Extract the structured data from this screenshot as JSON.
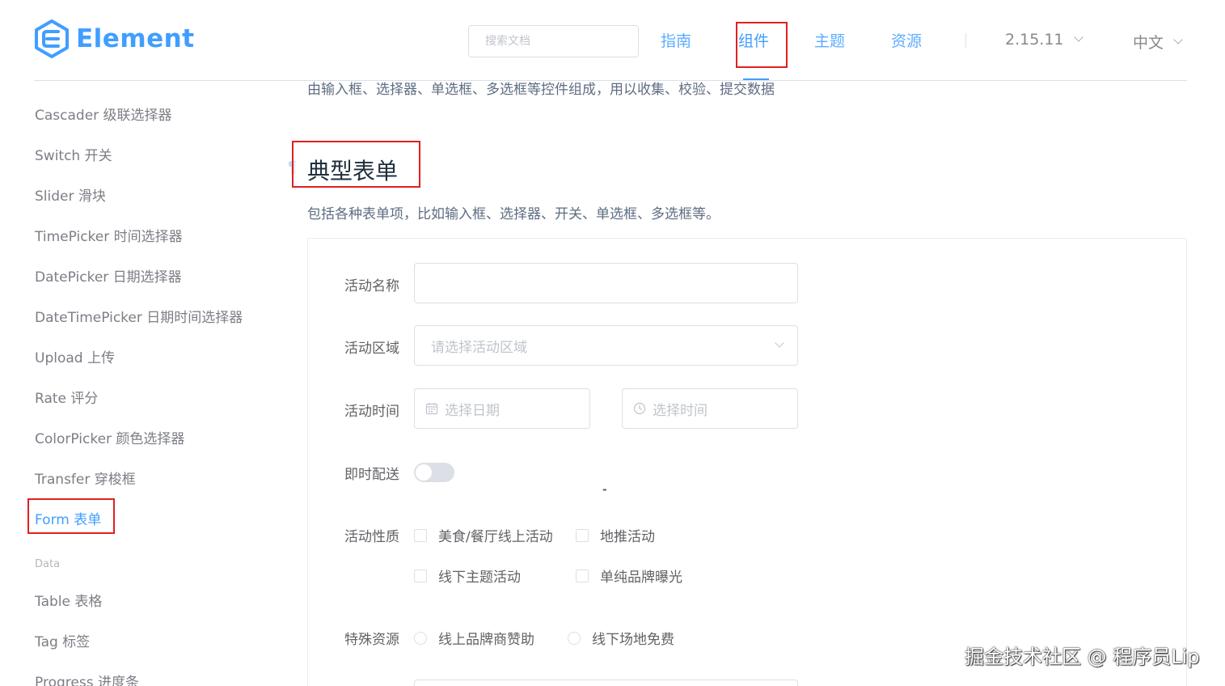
{
  "header": {
    "brand": "Element",
    "search_placeholder": "搜索文档",
    "nav": {
      "guide": "指南",
      "component": "组件",
      "theme": "主题",
      "resource": "资源"
    },
    "version": "2.15.11",
    "language": "中文"
  },
  "sidebar": {
    "items": [
      "Cascader 级联选择器",
      "Switch 开关",
      "Slider 滑块",
      "TimePicker 时间选择器",
      "DatePicker 日期选择器",
      "DateTimePicker 日期时间选择器",
      "Upload 上传",
      "Rate 评分",
      "ColorPicker 颜色选择器",
      "Transfer 穿梭框",
      "Form 表单"
    ],
    "group_data": "Data",
    "data_items": [
      "Table 表格",
      "Tag 标签",
      "Progress 进度条"
    ]
  },
  "main": {
    "intro": "由输入框、选择器、单选框、多选框等控件组成，用以收集、校验、提交数据",
    "title": "典型表单",
    "description": "包括各种表单项，比如输入框、选择器、开关、单选框、多选框等。",
    "form": {
      "name_label": "活动名称",
      "region_label": "活动区域",
      "region_placeholder": "请选择活动区域",
      "time_label": "活动时间",
      "date_placeholder": "选择日期",
      "time_placeholder": "选择时间",
      "dash": "-",
      "delivery_label": "即时配送",
      "type_label": "活动性质",
      "types": [
        "美食/餐厅线上活动",
        "地推活动",
        "线下主题活动",
        "单纯品牌曝光"
      ],
      "resource_label": "特殊资源",
      "resources": [
        "线上品牌商赞助",
        "线下场地免费"
      ]
    }
  },
  "watermark": "掘金技术社区 @ 程序员Lip",
  "colors": {
    "accent": "#409eff",
    "highlight_box": "#e02020"
  }
}
